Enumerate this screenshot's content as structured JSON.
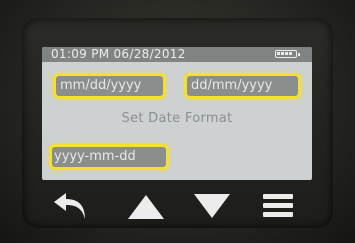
{
  "status_bar": {
    "datetime": "01:09 PM 06/28/2012",
    "battery_icon": "battery-icon"
  },
  "screen": {
    "title": "Set Date Format",
    "options": [
      {
        "label": "mm/dd/yyyy",
        "highlighted": true
      },
      {
        "label": "dd/mm/yyyy",
        "highlighted": true
      },
      {
        "label": "yyyy-mm-dd",
        "highlighted": true
      }
    ]
  },
  "nav_buttons": [
    {
      "icon": "back-arrow-icon"
    },
    {
      "icon": "up-triangle-icon"
    },
    {
      "icon": "down-triangle-icon"
    },
    {
      "icon": "menu-icon"
    }
  ],
  "colors": {
    "highlight": "#f4df33",
    "screen_bg": "#cdd1d1",
    "status_bar_bg": "#7f8483",
    "option_bg": "#8a8e8d"
  }
}
